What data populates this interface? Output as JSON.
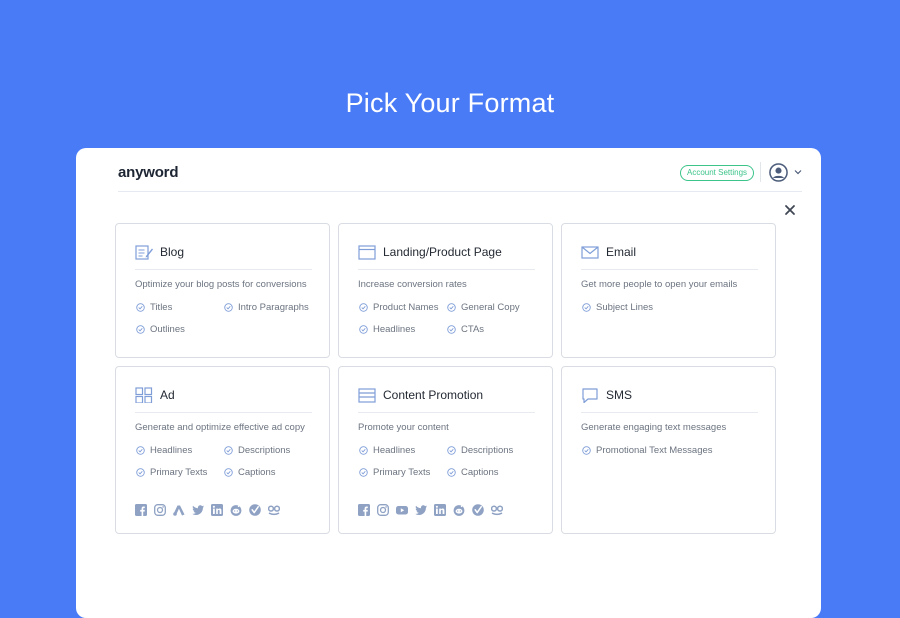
{
  "page": {
    "headline": "Pick Your Format"
  },
  "header": {
    "logo": "anyword",
    "account_settings_label": "Account Settings"
  },
  "cards": [
    {
      "id": "blog",
      "title": "Blog",
      "icon": "blog-edit-icon",
      "description": "Optimize your blog posts for conversions",
      "features": [
        "Titles",
        "Intro Paragraphs",
        "Outlines"
      ]
    },
    {
      "id": "landing",
      "title": "Landing/Product Page",
      "icon": "browser-window-icon",
      "description": "Increase conversion rates",
      "features": [
        "Product Names",
        "General Copy",
        "Headlines",
        "CTAs"
      ]
    },
    {
      "id": "email",
      "title": "Email",
      "icon": "envelope-icon",
      "description": "Get more people to open your emails",
      "features": [
        "Subject Lines"
      ]
    },
    {
      "id": "ad",
      "title": "Ad",
      "icon": "grid-icon",
      "description": "Generate and optimize effective ad copy",
      "features": [
        "Headlines",
        "Descriptions",
        "Primary Texts",
        "Captions"
      ],
      "platforms": [
        "facebook-icon",
        "instagram-icon",
        "google-ads-icon",
        "twitter-icon",
        "linkedin-icon",
        "reddit-icon",
        "verizon-check-icon",
        "taboola-icon"
      ]
    },
    {
      "id": "content-promotion",
      "title": "Content Promotion",
      "icon": "layout-rows-icon",
      "description": "Promote your content",
      "features": [
        "Headlines",
        "Descriptions",
        "Primary Texts",
        "Captions"
      ],
      "platforms": [
        "facebook-icon",
        "instagram-icon",
        "youtube-icon",
        "twitter-icon",
        "linkedin-icon",
        "reddit-icon",
        "verizon-check-icon",
        "taboola-icon"
      ]
    },
    {
      "id": "sms",
      "title": "SMS",
      "icon": "chat-bubble-icon",
      "description": "Generate engaging text messages",
      "features": [
        "Promotional Text Messages"
      ]
    }
  ],
  "colors": {
    "background": "#4a7bf7",
    "accent_green": "#3cc48a",
    "icon_blue": "#7f9ed8",
    "social_gray": "#8fa2c4"
  }
}
